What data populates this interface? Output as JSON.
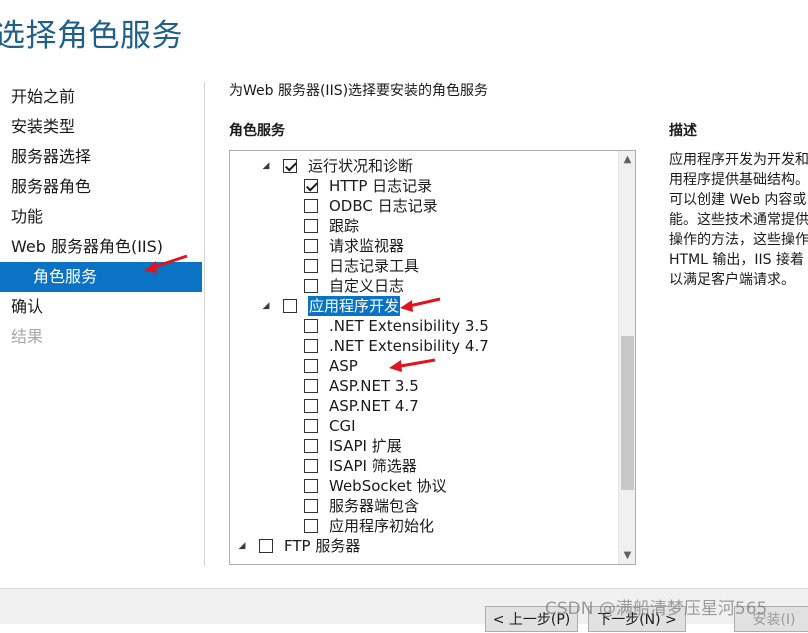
{
  "page": {
    "title": "选择角色服务"
  },
  "nav": {
    "items": [
      {
        "label": "开始之前",
        "state": "normal"
      },
      {
        "label": "安装类型",
        "state": "normal"
      },
      {
        "label": "服务器选择",
        "state": "normal"
      },
      {
        "label": "服务器角色",
        "state": "normal"
      },
      {
        "label": "功能",
        "state": "normal"
      },
      {
        "label": "Web 服务器角色(IIS)",
        "state": "normal"
      },
      {
        "label": "角色服务",
        "state": "active"
      },
      {
        "label": "确认",
        "state": "normal"
      },
      {
        "label": "结果",
        "state": "disabled"
      }
    ]
  },
  "main": {
    "instruction": "为Web 服务器(IIS)选择要安装的角色服务",
    "section_label": "角色服务",
    "tree": [
      {
        "label": "运行状况和诊断",
        "level": 1,
        "expander": "expanded",
        "checked": true,
        "selected": false
      },
      {
        "label": "HTTP 日志记录",
        "level": 2,
        "checked": true,
        "selected": false
      },
      {
        "label": "ODBC 日志记录",
        "level": 2,
        "checked": false,
        "selected": false
      },
      {
        "label": "跟踪",
        "level": 2,
        "checked": false,
        "selected": false
      },
      {
        "label": "请求监视器",
        "level": 2,
        "checked": false,
        "selected": false
      },
      {
        "label": "日志记录工具",
        "level": 2,
        "checked": false,
        "selected": false
      },
      {
        "label": "自定义日志",
        "level": 2,
        "checked": false,
        "selected": false
      },
      {
        "label": "应用程序开发",
        "level": 1,
        "expander": "expanded",
        "checked": false,
        "selected": true
      },
      {
        "label": ".NET Extensibility 3.5",
        "level": 2,
        "checked": false,
        "selected": false
      },
      {
        "label": ".NET Extensibility 4.7",
        "level": 2,
        "checked": false,
        "selected": false
      },
      {
        "label": "ASP",
        "level": 2,
        "checked": false,
        "selected": false
      },
      {
        "label": "ASP.NET 3.5",
        "level": 2,
        "checked": false,
        "selected": false
      },
      {
        "label": "ASP.NET 4.7",
        "level": 2,
        "checked": false,
        "selected": false
      },
      {
        "label": "CGI",
        "level": 2,
        "checked": false,
        "selected": false
      },
      {
        "label": "ISAPI 扩展",
        "level": 2,
        "checked": false,
        "selected": false
      },
      {
        "label": "ISAPI 筛选器",
        "level": 2,
        "checked": false,
        "selected": false
      },
      {
        "label": "WebSocket 协议",
        "level": 2,
        "checked": false,
        "selected": false
      },
      {
        "label": "服务器端包含",
        "level": 2,
        "checked": false,
        "selected": false
      },
      {
        "label": "应用程序初始化",
        "level": 2,
        "checked": false,
        "selected": false
      },
      {
        "label": "FTP 服务器",
        "level": 0,
        "expander": "expanded",
        "checked": false,
        "selected": false
      }
    ]
  },
  "description": {
    "title": "描述",
    "lines": [
      "应用程序开发为开发和",
      "用程序提供基础结构。",
      "可以创建 Web 内容或",
      "能。这些技术通常提供",
      "操作的方法，这些操作",
      "HTML 输出，IIS 接着",
      "以满足客户端请求。"
    ]
  },
  "footer": {
    "prev_label": "< 上一步(P)",
    "next_label": "下一步(N) >",
    "install_label": "安装(I)"
  },
  "watermark": "CSDN @满船清梦压星河565",
  "colors": {
    "accent": "#0a73c4",
    "title": "#1f5f8a",
    "annotation_arrow": "#e0141e"
  }
}
